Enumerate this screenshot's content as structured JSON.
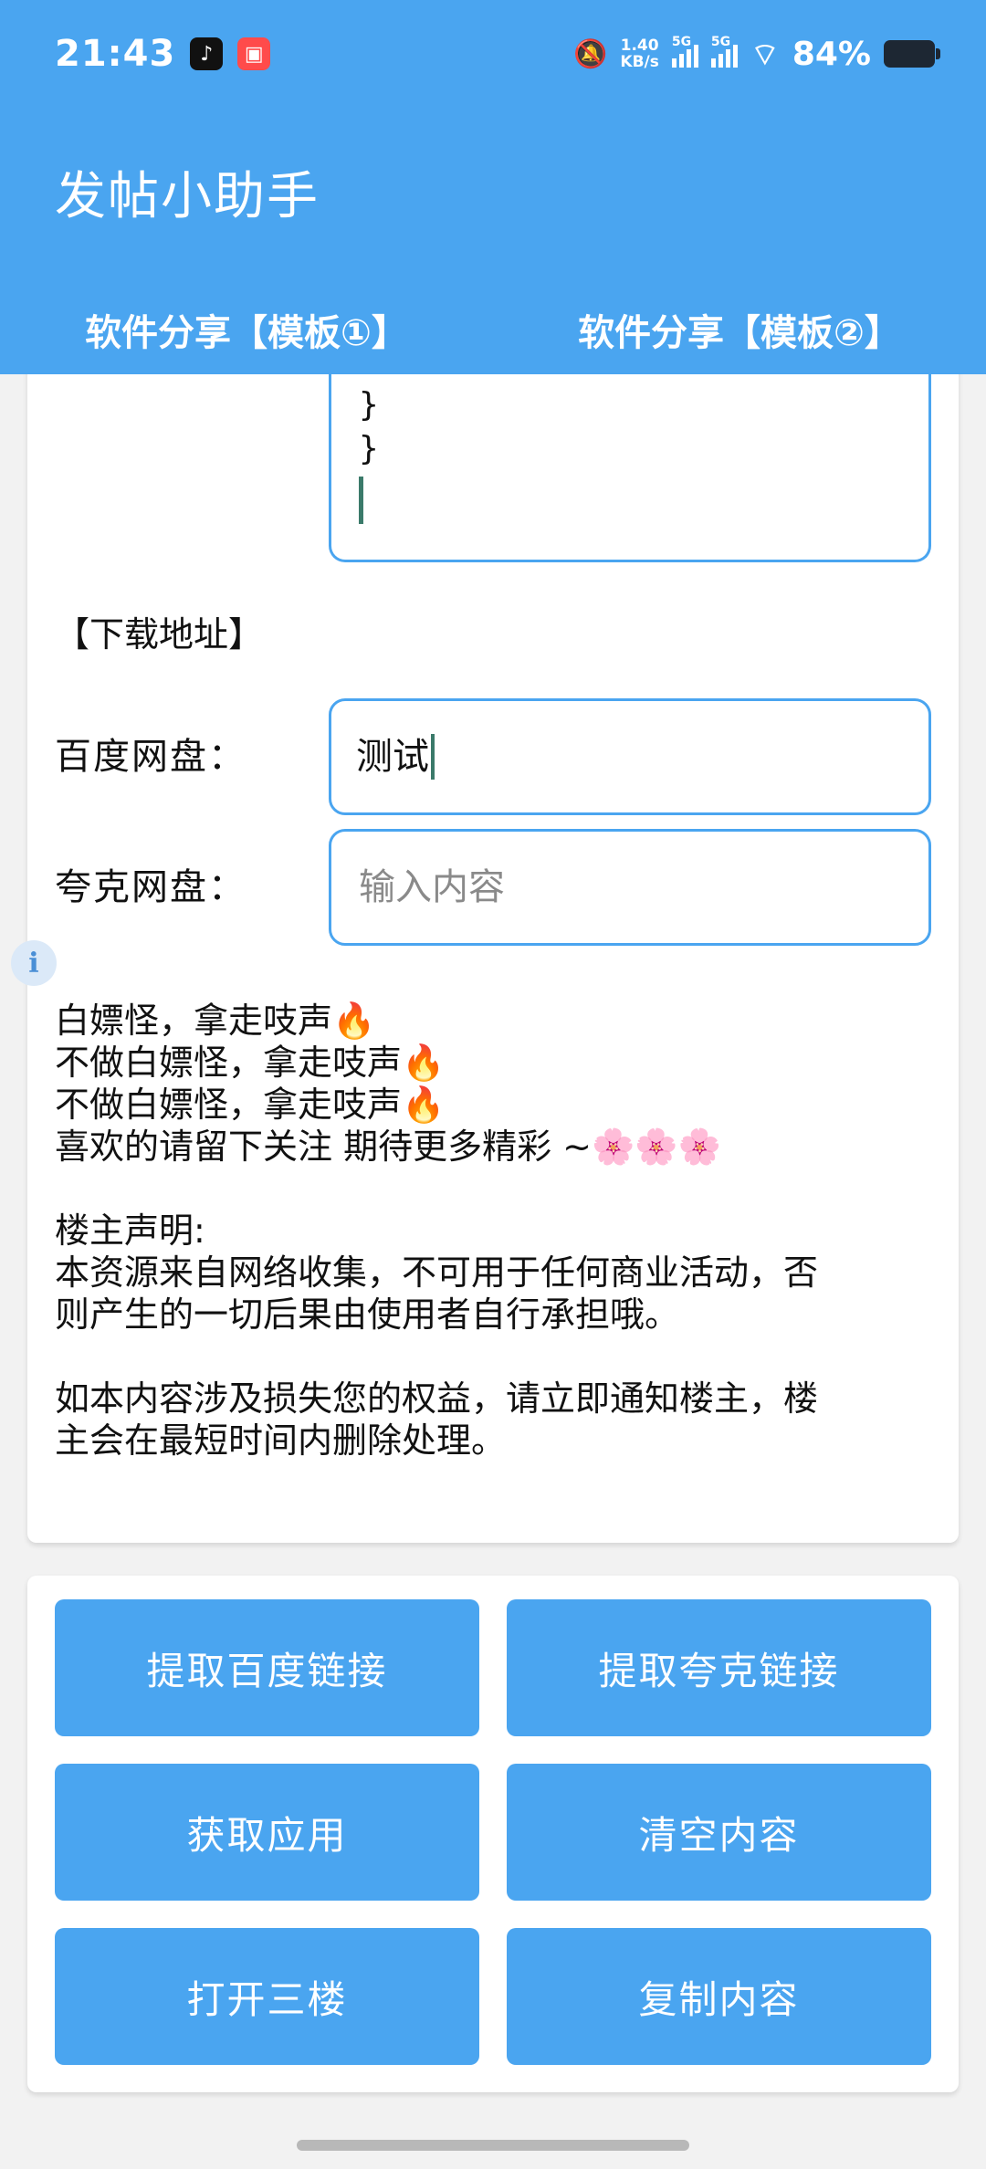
{
  "status_bar": {
    "time": "21:43",
    "app_icon_1": "♪",
    "app_icon_2": "▣",
    "mute_icon": "🔕",
    "net_speed_value": "1.40",
    "net_speed_unit": "KB/s",
    "sim1_tag": "5G",
    "sim2_tag": "5G",
    "wifi_icon": "⌔",
    "battery_percent": "84%"
  },
  "app": {
    "title": "发帖小助手"
  },
  "tabs": [
    {
      "label": "软件分享【模板①】"
    },
    {
      "label": "软件分享【模板②】"
    }
  ],
  "code_box": {
    "line_1": "}",
    "line_2": "}"
  },
  "download": {
    "section_label": "【下载地址】",
    "baidu_label": "百度网盘：",
    "baidu_value": "测试",
    "quark_label": "夸克网盘：",
    "quark_placeholder": "输入内容"
  },
  "info_icon": "i",
  "body": {
    "line_1": "白嫖怪，拿走吱声",
    "line_2": "不做白嫖怪，拿走吱声",
    "line_3": "不做白嫖怪，拿走吱声",
    "line_4": "喜欢的请留下关注 期待更多精彩 ~",
    "fire_emoji": "🔥",
    "flower_emoji": "🌸🌸🌸",
    "disclaimer_title": "楼主声明:",
    "disclaimer_line_1": "本资源来自网络收集，不可用于任何商业活动，否",
    "disclaimer_line_2": "则产生的一切后果由使用者自行承担哦。",
    "notice_line_1": "如本内容涉及损失您的权益，请立即通知楼主，楼",
    "notice_line_2": "主会在最短时间内删除处理。"
  },
  "buttons": {
    "extract_baidu": "提取百度链接",
    "extract_quark": "提取夸克链接",
    "get_app": "获取应用",
    "clear_content": "清空内容",
    "open_third_floor": "打开三楼",
    "copy_content": "复制内容"
  },
  "colors": {
    "primary": "#4aa5f0",
    "caret": "#3b7a6a",
    "background": "#f2f2f2"
  }
}
